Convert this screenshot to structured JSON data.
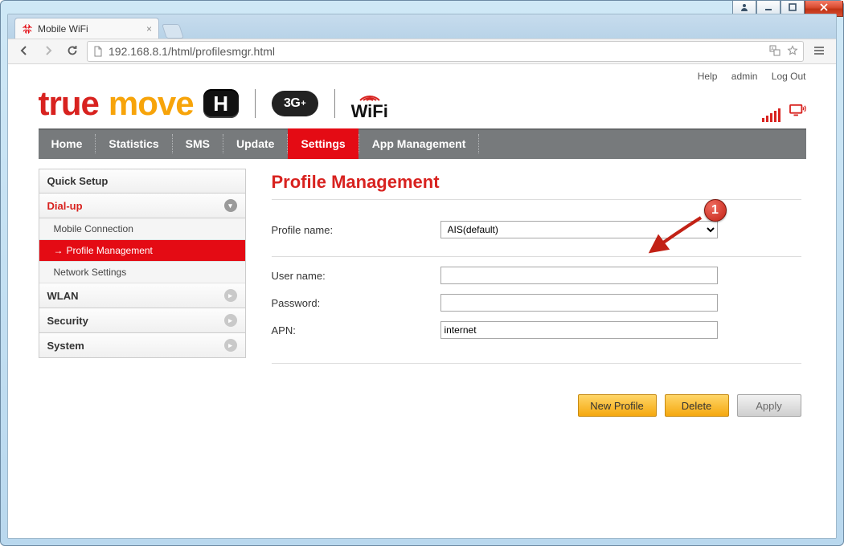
{
  "window": {
    "min_tooltip": "Minimize",
    "max_tooltip": "Maximize",
    "close_tooltip": "Close"
  },
  "browser": {
    "tab_title": "Mobile WiFi",
    "url": "192.168.8.1/html/profilesmgr.html"
  },
  "header": {
    "links": {
      "help": "Help",
      "user": "admin",
      "logout": "Log Out"
    },
    "logo": {
      "true_text": "true",
      "move_text": "move",
      "h_text": "H",
      "g3_text": "3G",
      "g3_plus": "+",
      "wifi_text_a": "W",
      "wifi_text_b": "i",
      "wifi_text_c": "Fi"
    }
  },
  "nav": {
    "items": [
      {
        "label": "Home"
      },
      {
        "label": "Statistics"
      },
      {
        "label": "SMS"
      },
      {
        "label": "Update"
      },
      {
        "label": "Settings",
        "active": true
      },
      {
        "label": "App Management"
      }
    ]
  },
  "sidebar": {
    "quick_setup": "Quick Setup",
    "dialup": "Dial-up",
    "dialup_items": {
      "mobile_connection": "Mobile Connection",
      "profile_management": "Profile Management",
      "network_settings": "Network Settings"
    },
    "wlan": "WLAN",
    "security": "Security",
    "system": "System"
  },
  "panel": {
    "title": "Profile Management",
    "labels": {
      "profile_name": "Profile name:",
      "user_name": "User name:",
      "password": "Password:",
      "apn": "APN:"
    },
    "values": {
      "profile_name_selected": "AIS(default)",
      "user_name": "",
      "password": "",
      "apn": "internet"
    },
    "buttons": {
      "new_profile": "New Profile",
      "delete": "Delete",
      "apply": "Apply"
    }
  },
  "annotation": {
    "badge_text": "1"
  }
}
